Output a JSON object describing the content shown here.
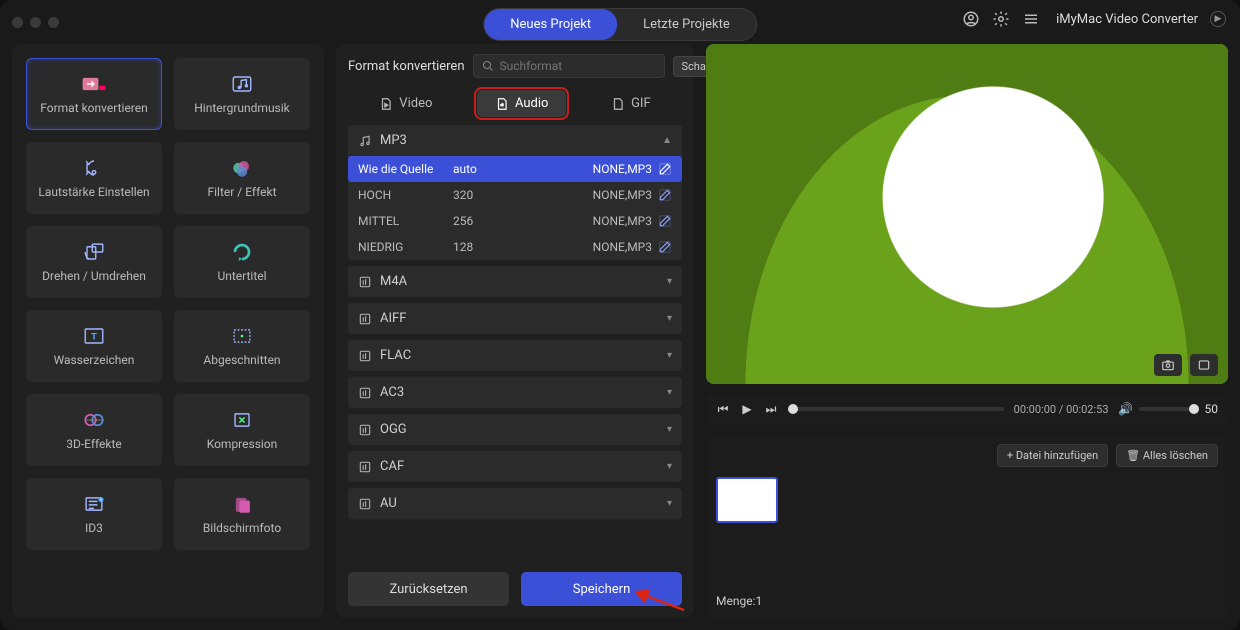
{
  "header": {
    "tab_new": "Neues Projekt",
    "tab_recent": "Letzte Projekte",
    "brand": "iMyMac Video Converter"
  },
  "sidebar": {
    "tiles": [
      {
        "label": "Format konvertieren",
        "icon": "convert"
      },
      {
        "label": "Hintergrundmusik",
        "icon": "music"
      },
      {
        "label": "Lautstärke Einstellen",
        "icon": "volume"
      },
      {
        "label": "Filter / Effekt",
        "icon": "filter"
      },
      {
        "label": "Drehen / Umdrehen",
        "icon": "rotate"
      },
      {
        "label": "Untertitel",
        "icon": "subtitle"
      },
      {
        "label": "Wasserzeichen",
        "icon": "watermark"
      },
      {
        "label": "Abgeschnitten",
        "icon": "crop"
      },
      {
        "label": "3D-Effekte",
        "icon": "3d"
      },
      {
        "label": "Kompression",
        "icon": "compress"
      },
      {
        "label": "ID3",
        "icon": "id3"
      },
      {
        "label": "Bildschirmfoto",
        "icon": "screenshot"
      }
    ],
    "selected": 0
  },
  "mid": {
    "title": "Format konvertieren",
    "search_placeholder": "Suchformat",
    "create_btn": "Schaffen",
    "tabs": {
      "video": "Video",
      "audio": "Audio",
      "gif": "GIF"
    },
    "active_tab": "audio",
    "formats": {
      "open": "MP3",
      "presets": [
        {
          "name": "Wie die Quelle",
          "bitrate": "auto",
          "codec": "NONE,MP3",
          "selected": true
        },
        {
          "name": "HOCH",
          "bitrate": "320",
          "codec": "NONE,MP3"
        },
        {
          "name": "MITTEL",
          "bitrate": "256",
          "codec": "NONE,MP3"
        },
        {
          "name": "NIEDRIG",
          "bitrate": "128",
          "codec": "NONE,MP3"
        }
      ],
      "collapsed": [
        "M4A",
        "AIFF",
        "FLAC",
        "AC3",
        "OGG",
        "CAF",
        "AU"
      ]
    },
    "reset_btn": "Zurücksetzen",
    "save_btn": "Speichern"
  },
  "player": {
    "current": "00:00:00",
    "total": "00:02:53",
    "volume": "50"
  },
  "queue": {
    "add_btn": "Datei hinzufügen",
    "clear_btn": "Alles löschen",
    "count_label": "Menge:",
    "count_value": "1"
  }
}
